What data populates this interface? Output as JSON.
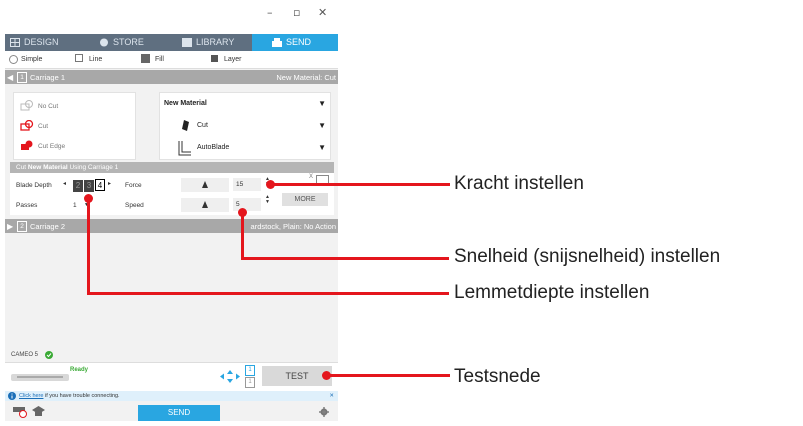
{
  "window": {
    "minimize": "–",
    "restore": "▫",
    "close": "✕"
  },
  "tabs": [
    {
      "label": "DESIGN",
      "icon": "grid-icon"
    },
    {
      "label": "STORE",
      "icon": "store-icon"
    },
    {
      "label": "LIBRARY",
      "icon": "library-icon"
    },
    {
      "label": "SEND",
      "icon": "send-icon"
    }
  ],
  "modes": {
    "simple": "Simple",
    "line": "Line",
    "fill": "Fill",
    "layer": "Layer"
  },
  "carriage1": {
    "number": "1",
    "label": "Carriage 1",
    "right": "New Material: Cut"
  },
  "cut_styles": [
    "No Cut",
    "Cut",
    "Cut Edge"
  ],
  "material": {
    "name": "New Material",
    "action": "Cut",
    "tool": "AutoBlade"
  },
  "cutline": {
    "prefix": "Cut ",
    "material": "New Material",
    "suffix": " Using Carriage 1"
  },
  "settings": {
    "blade_depth_label": "Blade Depth",
    "depth_values": [
      "2",
      "3",
      "4"
    ],
    "passes_label": "Passes",
    "passes_value": "1",
    "force_label": "Force",
    "force_value": "15",
    "speed_label": "Speed",
    "speed_value": "5",
    "more_label": "MORE",
    "x_label": "X"
  },
  "carriage2": {
    "number": "2",
    "label": "Carriage 2",
    "right": "ardstock, Plain: No Action"
  },
  "device": {
    "name": "CAMEO 5",
    "status": "Ready",
    "test_label": "TEST",
    "pos1": "1",
    "pos2": "1"
  },
  "info": {
    "link": "Click here",
    "text": " if you have trouble connecting."
  },
  "send_label": "SEND",
  "annotations": {
    "force": "Kracht instellen",
    "speed": "Snelheid (snijsnelheid) instellen",
    "depth": "Lemmetdiepte instellen",
    "test": "Testsnede"
  },
  "colors": {
    "accent": "#29a6e1",
    "annotation": "#e4161d",
    "tabbar": "#5f6f80"
  }
}
